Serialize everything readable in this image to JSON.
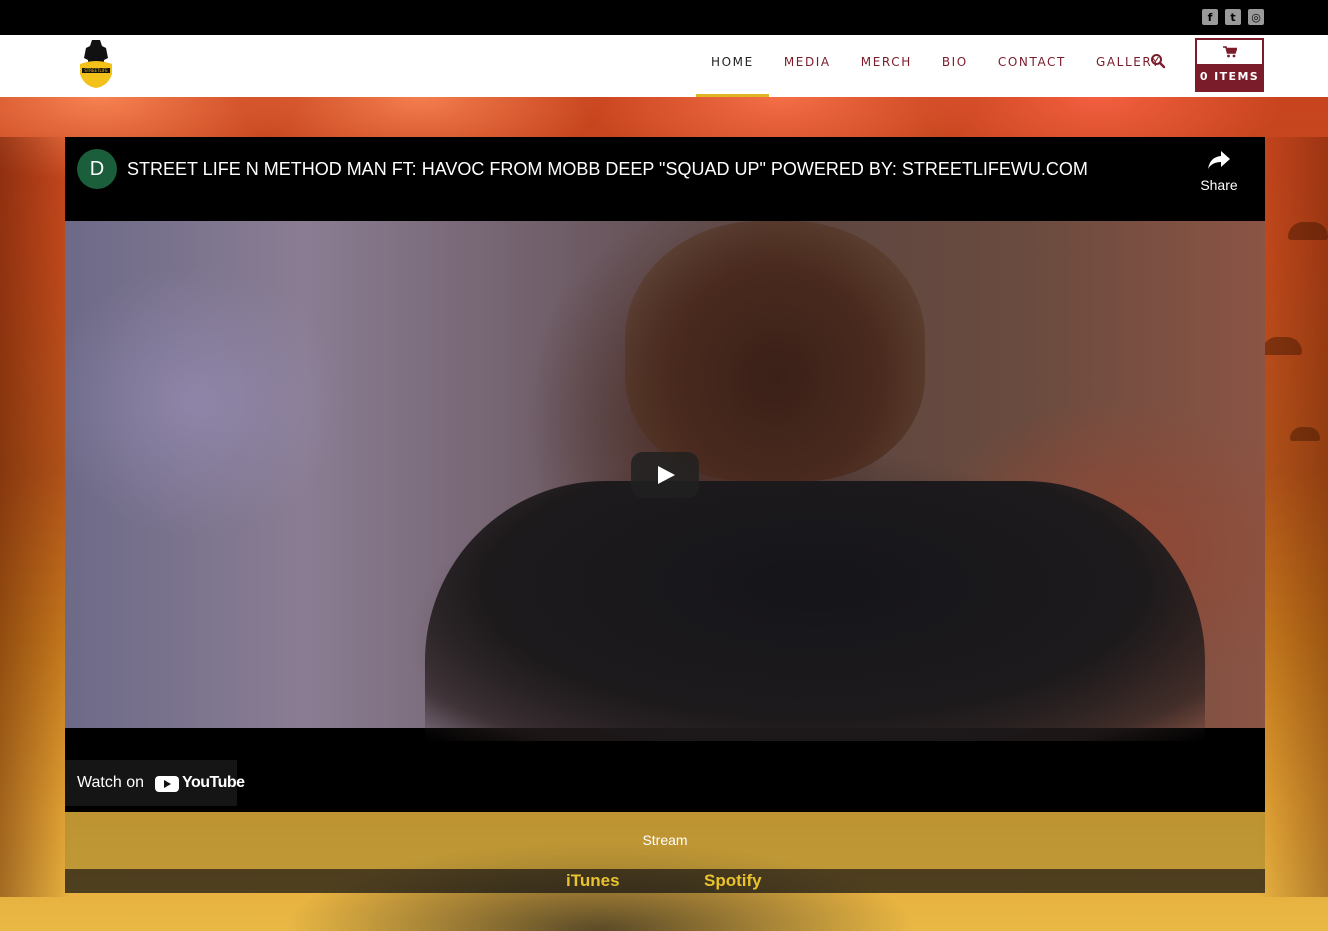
{
  "social": {
    "icons": [
      "facebook-icon",
      "twitter-icon",
      "instagram-icon"
    ]
  },
  "header": {
    "logo_text": "STREETLIFE",
    "nav": [
      {
        "label": "HOME",
        "active": true
      },
      {
        "label": "MEDIA",
        "active": false
      },
      {
        "label": "MERCH",
        "active": false
      },
      {
        "label": "BIO",
        "active": false
      },
      {
        "label": "CONTACT",
        "active": false
      },
      {
        "label": "GALLERY",
        "active": false
      }
    ],
    "search_icon": "search-icon",
    "cart": {
      "icon": "cart-icon",
      "label": "0 ITEMS"
    }
  },
  "video": {
    "channel_initial": "D",
    "title": "STREET LIFE N METHOD MAN FT: HAVOC FROM MOBB DEEP \"SQUAD UP\" POWERED BY: STREETLIFEWU.COM",
    "share_label": "Share",
    "watch_on_label": "Watch on",
    "youtube_label": "YouTube"
  },
  "stream": {
    "title": "Stream",
    "links": [
      "iTunes",
      "Spotify"
    ]
  },
  "colors": {
    "accent": "#7a1c2a",
    "active_underline": "#e0b624",
    "stream_link": "#e8c32f"
  }
}
